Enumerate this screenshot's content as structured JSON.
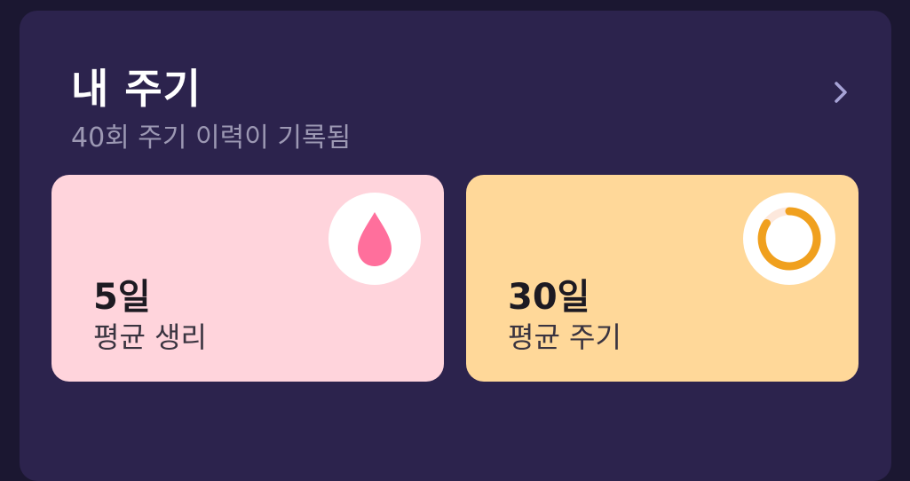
{
  "header": {
    "title": "내 주기",
    "subtitle": "40회 주기 이력이 기록됨",
    "chevron_icon": "chevron-right-icon"
  },
  "cards": [
    {
      "value": "5일",
      "label": "평균 생리",
      "icon": "blood-drop-icon",
      "background": "#ffd4dc",
      "icon_color": "#ff6f9c"
    },
    {
      "value": "30일",
      "label": "평균 주기",
      "icon": "cycle-ring-icon",
      "background": "#ffd899",
      "icon_color": "#f0a01e"
    }
  ],
  "colors": {
    "page_background": "#1b1731",
    "panel_background": "#2c234d",
    "chevron": "#a7a3d6"
  }
}
